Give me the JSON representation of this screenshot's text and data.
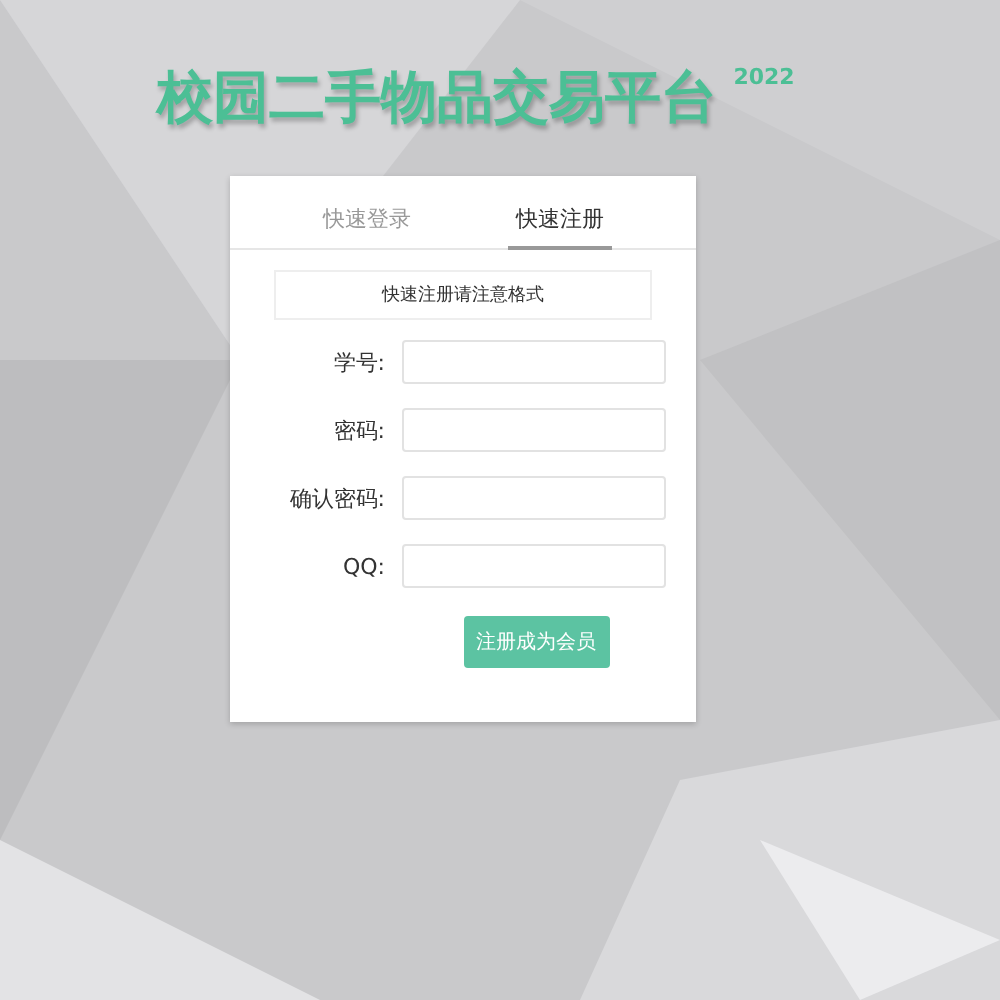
{
  "header": {
    "title": "校园二手物品交易平台",
    "year": "2022"
  },
  "tabs": [
    {
      "label": "快速登录",
      "selected": false
    },
    {
      "label": "快速注册",
      "selected": true
    }
  ],
  "notice": "快速注册请注意格式",
  "fields": [
    {
      "label": "学号:"
    },
    {
      "label": "密码:"
    },
    {
      "label": "确认密码:"
    },
    {
      "label": "QQ:"
    }
  ],
  "submit_button": "注册成为会员"
}
